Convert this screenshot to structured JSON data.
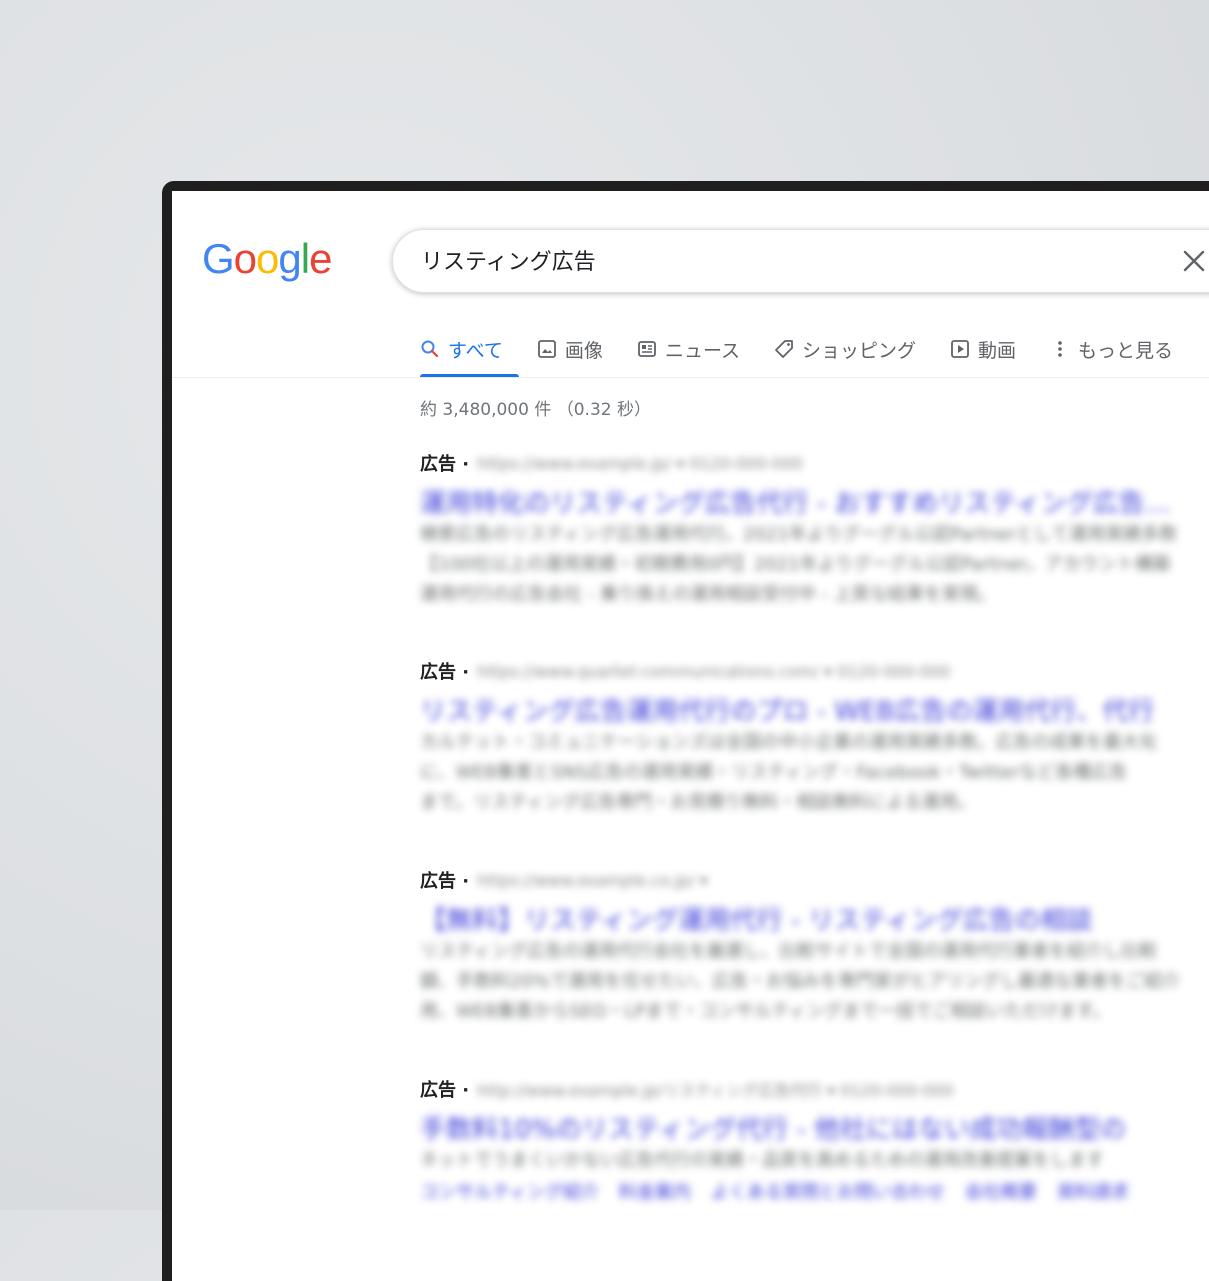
{
  "search": {
    "query": "リスティング広告"
  },
  "logo": {
    "letters": [
      "G",
      "o",
      "o",
      "g",
      "l",
      "e"
    ],
    "colors": [
      "#4285F4",
      "#EA4335",
      "#FBBC05",
      "#4285F4",
      "#34A853",
      "#EA4335"
    ]
  },
  "tabs": [
    {
      "label": "すべて",
      "icon": "search-icon",
      "active": true
    },
    {
      "label": "画像",
      "icon": "image-icon",
      "active": false
    },
    {
      "label": "ニュース",
      "icon": "news-icon",
      "active": false
    },
    {
      "label": "ショッピング",
      "icon": "tag-icon",
      "active": false
    },
    {
      "label": "動画",
      "icon": "play-icon",
      "active": false
    },
    {
      "label": "もっと見る",
      "icon": "more-vert-icon",
      "active": false
    }
  ],
  "stats": "約 3,480,000 件 （0.32 秒）",
  "results": [
    {
      "ad_label": "広告 ·",
      "url": "https://www.example.jp/ ▾ 0120-000-000",
      "title": "運用特化のリスティング広告代行 - おすすめリスティング広告…",
      "desc": [
        "検索広告のリスティング広告運用代行。2021年よりグーグル公認Partnerとして運用実績多数",
        "【100社以上の運用実績・初期費用0円】2021年よりグーグル公認Partner。アカウント構築",
        "運用代行の広告会社 - 乗り換えの運用相談受付中 - 上質な結果を実現。"
      ]
    },
    {
      "ad_label": "広告 ·",
      "url": "https://www.quartet-communications.com/ ▾ 0120-000-000",
      "title": "リスティング広告運用代行のプロ - WEB広告の運用代行、代行",
      "desc": [
        "カルテット・コミュニケーションズは全国の中小企業の運用実績多数。広告の成果を最大化",
        "に、WEB集客とSNS広告の運用実績・リスティング・Facebook・Twitterなど各種広告",
        "まで。リスティング広告専門・お見積り無料・相談無料による運用。"
      ]
    },
    {
      "ad_label": "広告 ·",
      "url": "https://www.example.co.jp/ ▾",
      "title": "【無料】リスティング運用代行 - リスティング広告の相談",
      "desc": [
        "リスティング広告の運用代行会社を厳選し、比較サイトで全国の運用代行業者を紹介し比較",
        "額、手数料20%で運用を任せたい、広告・お悩みを専門家がヒアリングし最適な業者をご紹介",
        "用、WEB集客からSEO・LPまで・コンサルティングまで一括でご相談いただけます。"
      ]
    },
    {
      "ad_label": "広告 ·",
      "url": "http://www.example.jp/リスティング広告代行 ▾ 0120-000-000",
      "title": "手数料10%のリスティング代行 - 他社にはない成功報酬型の",
      "desc": [
        "ネットでうまくいかない広告代行の実績・品質を高めるための運用改善提案をします"
      ],
      "sitelinks": [
        "コンサルティング紹介",
        "料金案内",
        "よくある質問とお問い合わせ",
        "会社概要",
        "資料請求"
      ]
    }
  ]
}
